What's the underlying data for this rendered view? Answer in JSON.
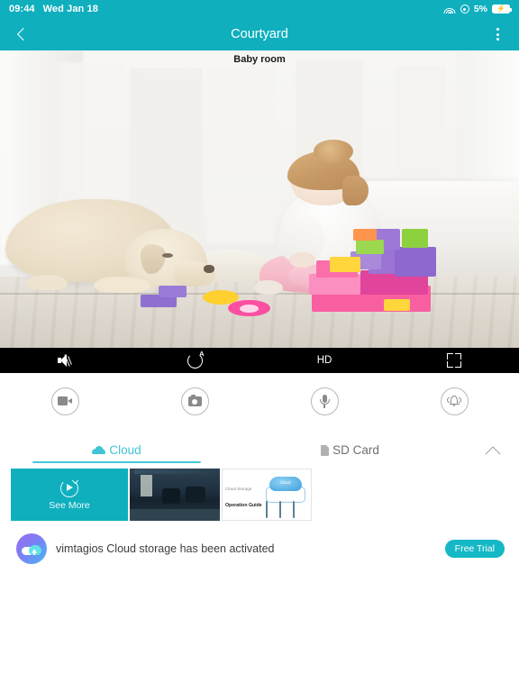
{
  "status_bar": {
    "time": "09:44",
    "date": "Wed Jan 18",
    "wifi_icon": "wifi-icon",
    "location_icon": "location-dot-icon",
    "battery_percent": "5%",
    "battery_icon": "battery-charging-icon",
    "background_color": "#0fafbe"
  },
  "nav_bar": {
    "back_icon": "chevron-left-icon",
    "title": "Courtyard",
    "menu_icon": "more-vertical-icon",
    "background_color": "#0fafbe"
  },
  "video": {
    "channel_label": "Baby room",
    "scene_description": "Baby room with a cream Labrador dog lying on the floor facing a young blonde girl in a white sweater and pink leggings sitting beside a tower of pink, purple, green and yellow building blocks"
  },
  "video_controls": {
    "items": [
      {
        "name": "mute-toggle",
        "icon": "speaker-muted-icon",
        "label": ""
      },
      {
        "name": "ptz-control",
        "icon": "ptz-auto-icon",
        "label": ""
      },
      {
        "name": "quality-selector",
        "icon": "",
        "label": "HD"
      },
      {
        "name": "fullscreen-toggle",
        "icon": "fullscreen-icon",
        "label": ""
      }
    ],
    "background_color": "#000000"
  },
  "actions": {
    "items": [
      {
        "name": "record-button",
        "icon": "video-camera-icon"
      },
      {
        "name": "snapshot-button",
        "icon": "camera-icon"
      },
      {
        "name": "talk-button",
        "icon": "microphone-icon"
      },
      {
        "name": "alarm-button",
        "icon": "bell-alert-icon"
      }
    ]
  },
  "tabs": {
    "items": [
      {
        "label": "Cloud",
        "icon": "cloud-icon",
        "active": true
      },
      {
        "label": "SD Card",
        "icon": "sd-card-icon",
        "active": false
      }
    ],
    "collapse_icon": "chevron-up-icon",
    "active_color": "#3fc4d6",
    "inactive_color": "#6e6e6e"
  },
  "cards": {
    "see_more": {
      "label": "See More",
      "icon": "replay-icon",
      "background_color": "#0fafbe"
    },
    "thumbnail": {
      "name": "cloud-clip-thumbnail"
    },
    "guide": {
      "line1": "Cloud Storage",
      "line2": "Operation Guide",
      "cloud_label": "Cloud"
    }
  },
  "notification": {
    "avatar_icon": "cloud-upload-avatar",
    "message": "vimtagios Cloud storage has been activated",
    "badge": "Free Trial",
    "badge_color": "#15b8c6"
  }
}
